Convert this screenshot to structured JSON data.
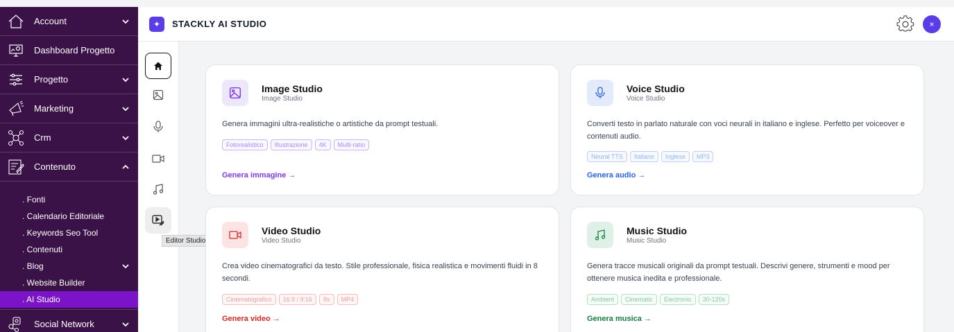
{
  "sidebar": {
    "items": [
      {
        "label": "Account",
        "icon": "home-icon"
      },
      {
        "label": "Dashboard Progetto",
        "icon": "monitor-icon"
      },
      {
        "label": "Progetto",
        "icon": "sliders-icon"
      },
      {
        "label": "Marketing",
        "icon": "megaphone-icon"
      },
      {
        "label": "Crm",
        "icon": "people-network-icon"
      },
      {
        "label": "Contenuto",
        "icon": "edit-doc-icon"
      }
    ],
    "contenuto_sub": [
      {
        "label": ". Fonti"
      },
      {
        "label": ". Calendario Editoriale"
      },
      {
        "label": ". Keywords Seo Tool"
      },
      {
        "label": ". Contenuti"
      },
      {
        "label": ". Blog"
      },
      {
        "label": ". Website Builder"
      },
      {
        "label": ". AI Studio"
      }
    ],
    "social": {
      "label": "Social Network",
      "icon": "social-icon"
    }
  },
  "topbar": {
    "brand": "STACKLY AI STUDIO",
    "logo_glyph": "✦",
    "close_glyph": "×"
  },
  "rail": {
    "tooltip": "Editor Studio"
  },
  "cards": [
    {
      "title": "Image Studio",
      "subtitle": "Image Studio",
      "desc": "Genera immagini ultra-realistiche o artistiche da prompt testuali.",
      "tags": [
        "Fotorealistico",
        "Illustrazione",
        "4K",
        "Multi-ratio"
      ],
      "cta": "Genera immagine →",
      "color": "#7c3aed",
      "bg": "#ede7fb"
    },
    {
      "title": "Voice Studio",
      "subtitle": "Voice Studio",
      "desc": "Converti testo in parlato naturale con voci neurali in italiano e inglese. Perfetto per voiceover e contenuti audio.",
      "tags": [
        "Neural TTS",
        "Italiano",
        "Inglese",
        "MP3"
      ],
      "cta": "Genera audio →",
      "color": "#2563eb",
      "bg": "#e2eafc"
    },
    {
      "title": "Video Studio",
      "subtitle": "Video Studio",
      "desc": "Crea video cinematografici da testo. Stile professionale, fisica realistica e movimenti fluidi in 8 secondi.",
      "tags": [
        "Cinematografico",
        "16:9 / 9:16",
        "8s",
        "MP4"
      ],
      "cta": "Genera video →",
      "color": "#dc2626",
      "bg": "#fde4e4"
    },
    {
      "title": "Music Studio",
      "subtitle": "Music Studio",
      "desc": "Genera tracce musicali originali da prompt testuali. Descrivi genere, strumenti e mood per ottenere musica inedita e professionale.",
      "tags": [
        "Ambient",
        "Cinematic",
        "Electronic",
        "30-120s"
      ],
      "cta": "Genera musica →",
      "color": "#15803d",
      "bg": "#dff1e6"
    }
  ]
}
